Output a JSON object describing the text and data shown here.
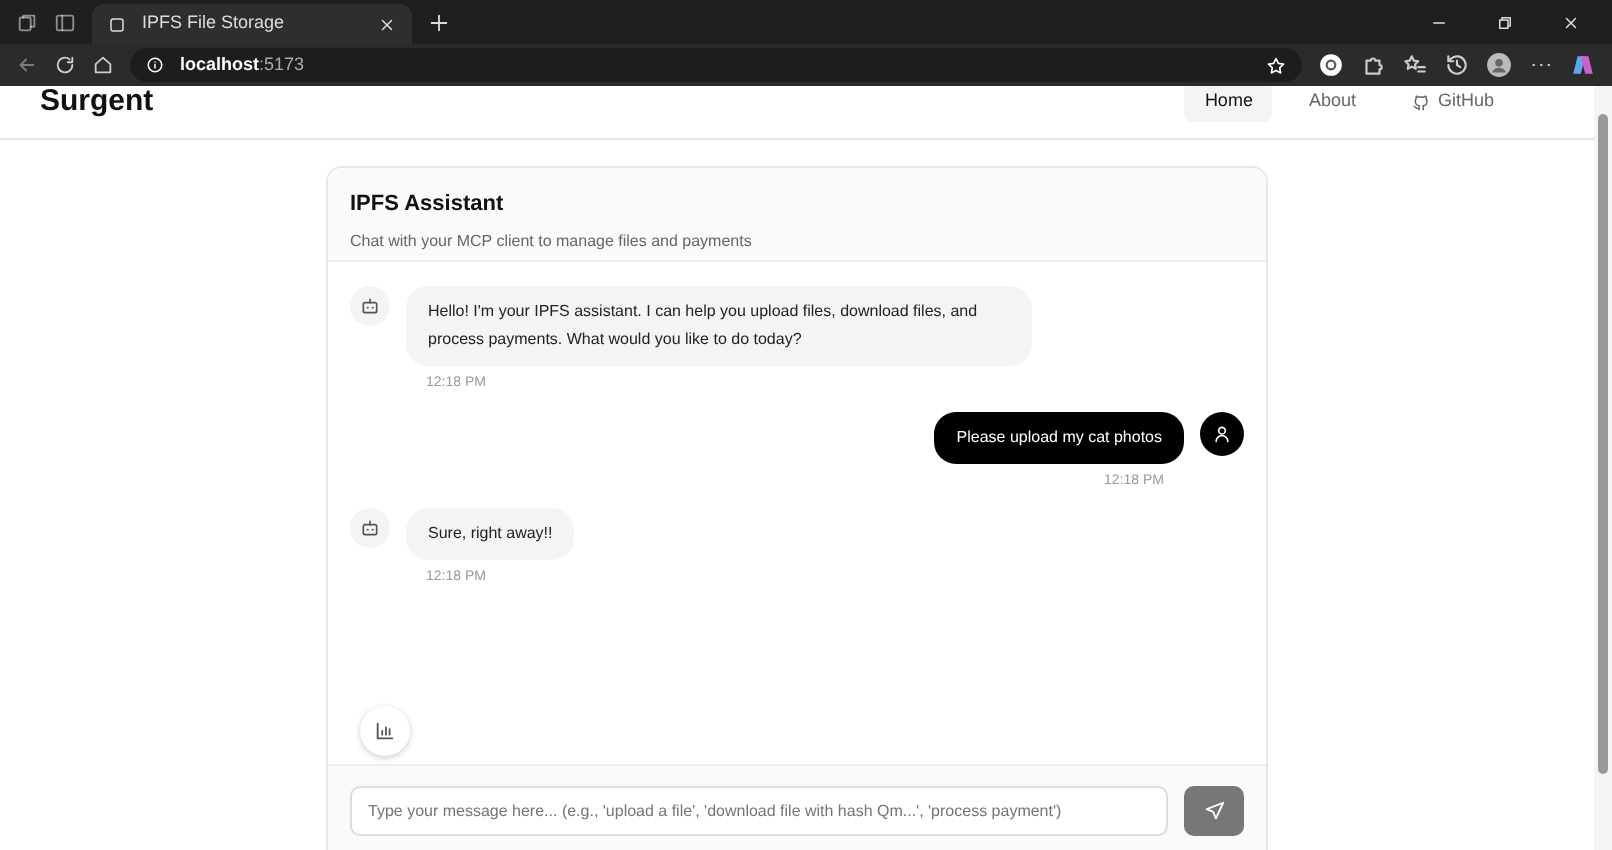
{
  "browser": {
    "tabs": [
      {
        "title": "IPFS File Storage",
        "selected": true
      }
    ],
    "address": {
      "host": "localhost",
      "port": ":5173"
    }
  },
  "site": {
    "brand": "Surgent",
    "nav": [
      {
        "label": "Home",
        "selected": true,
        "kind": "text"
      },
      {
        "label": "About",
        "selected": false,
        "kind": "text"
      },
      {
        "label": "GitHub",
        "selected": false,
        "kind": "github"
      }
    ]
  },
  "chat": {
    "title": "IPFS Assistant",
    "subtitle": "Chat with your MCP client to manage files and payments",
    "messages": [
      {
        "kind": "assistant",
        "text": "Hello! I'm your IPFS assistant. I can help you upload files, download files, and process payments. What would you like to do today?",
        "time": "12:18 PM"
      },
      {
        "kind": "user",
        "text": "Please upload my cat photos",
        "time": "12:18 PM"
      },
      {
        "kind": "assistant",
        "text": "Sure, right away!!",
        "time": "12:18 PM"
      }
    ],
    "input": {
      "placeholder": "Type your message here... (e.g., 'upload a file', 'download file with hash Qm...', 'process payment')"
    }
  }
}
